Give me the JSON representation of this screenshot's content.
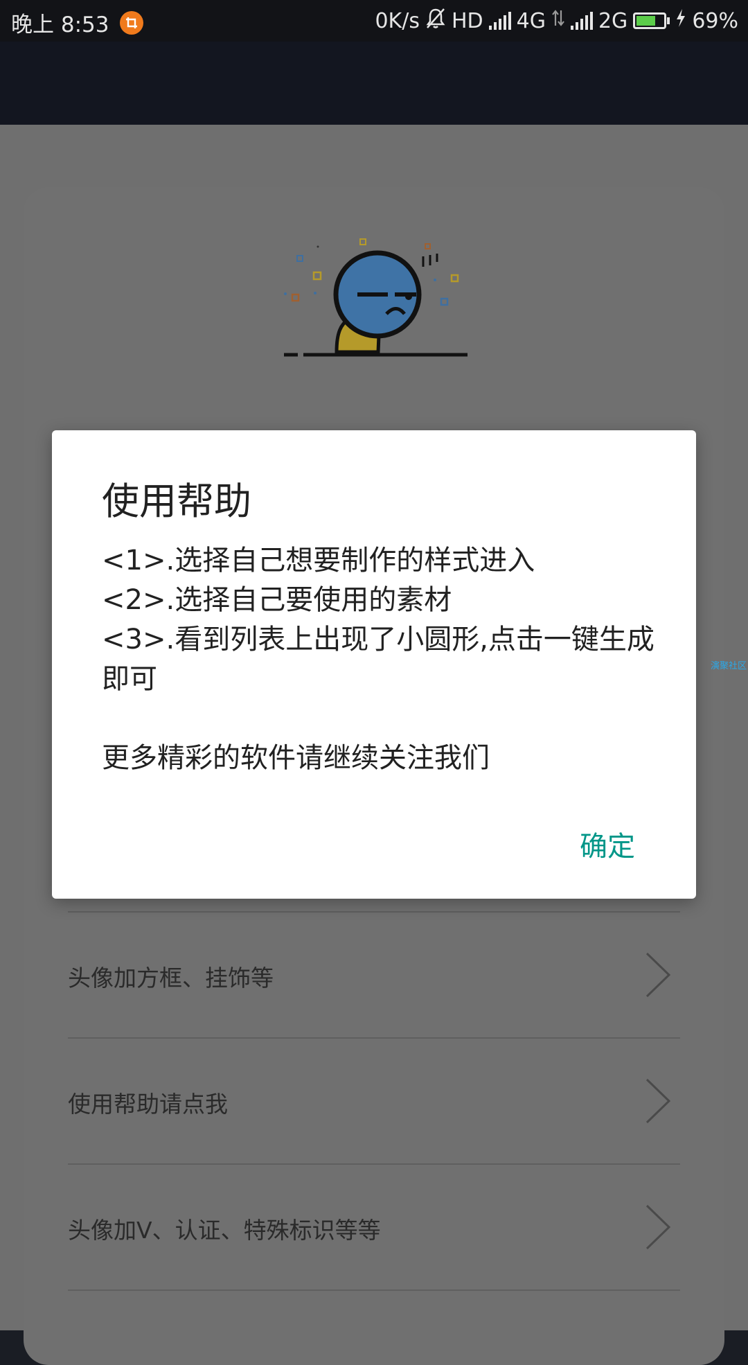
{
  "status_bar": {
    "time": "晚上 8:53",
    "net_speed": "0K/s",
    "hd": "HD",
    "net1": "4G",
    "net2": "2G",
    "battery_percent": "69%",
    "battery_level": 0.69,
    "notification_icon": "screenshot-crop-icon",
    "colors": {
      "battery_fill": "#5ccd4a",
      "notif": "#f07a1c"
    }
  },
  "dialog": {
    "title": "使用帮助",
    "lines": [
      "<1>.选择自己想要制作的样式进入",
      "<2>.选择自己要使用的素材",
      "<3>.看到列表上出现了小圆形,点击一键生成即可",
      "更多精彩的软件请继续关注我们"
    ],
    "confirm_label": "确定",
    "accent": "#009688"
  },
  "list": {
    "items": [
      {
        "label": "头像加方框、挂饰等",
        "icon": "chevron-right-icon"
      },
      {
        "label": "使用帮助请点我",
        "icon": "chevron-right-icon"
      },
      {
        "label": "头像加V、认证、特殊标识等等",
        "icon": "chevron-right-icon"
      }
    ]
  },
  "watermark": "演聚社区"
}
